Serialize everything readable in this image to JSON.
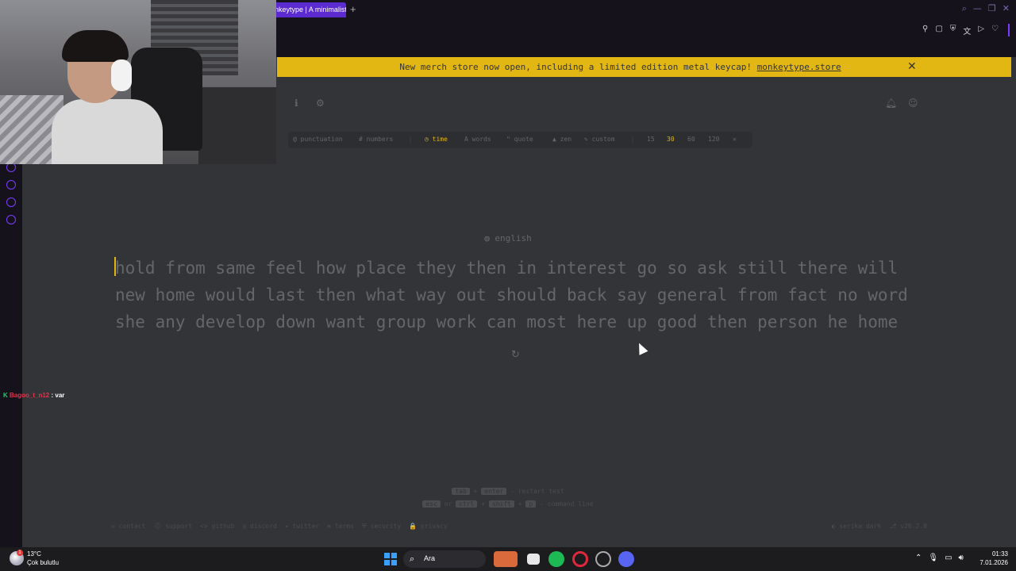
{
  "browser": {
    "tab_title": "nkeytype | A minimalist",
    "new_tab": "+"
  },
  "banner": {
    "text": "New merch store now open, including a limited edition metal keycap!",
    "link": "monkeytype.store",
    "close": "✕"
  },
  "config": {
    "punctuation": "@ punctuation",
    "numbers": "# numbers",
    "time": "◷ time",
    "words": "A words",
    "quote": "❝ quote",
    "zen": "▲ zen",
    "custom": "✎ custom",
    "t15": "15",
    "t30": "30",
    "t60": "60",
    "t120": "120",
    "tools": "✕"
  },
  "test": {
    "language": "◍ english",
    "line1": "hold from same feel how place they then in interest go so ask still there will",
    "line2": "new home would last then what way out should back say general from fact no word",
    "line3": "she any develop down want group work can most here up good then person he home",
    "restart_icon": "↻"
  },
  "chat": {
    "badge": "K",
    "user": "Bagoo_t_n12",
    "msg": ": var"
  },
  "hints": {
    "tab": "tab",
    "plus": "+",
    "enter": "enter",
    "restart": "- restart test",
    "esc": "esc",
    "or": "or",
    "ctrl": "ctrl",
    "plus2": "+",
    "shift": "shift",
    "plus3": "+",
    "p": "p",
    "command": "- command line"
  },
  "footer": {
    "contact": "✉ contact",
    "support": "⛑ support",
    "github": "<> github",
    "discord": "◎ discord",
    "twitter": "✦ twitter",
    "terms": "≡ terms",
    "security": "⛨ security",
    "privacy": "🔒 privacy",
    "theme": "◐ serika dark",
    "version": "⎇ v26.2.0"
  },
  "taskbar": {
    "temp": "13°C",
    "weather": "Çok bulutlu",
    "badge": "1",
    "search": "Ara",
    "time": "01:33",
    "date": "7.01.2026"
  },
  "colors": {
    "bg": "#323437",
    "main": "#e2b714",
    "sub": "#646669",
    "banner": "#e2b714"
  }
}
